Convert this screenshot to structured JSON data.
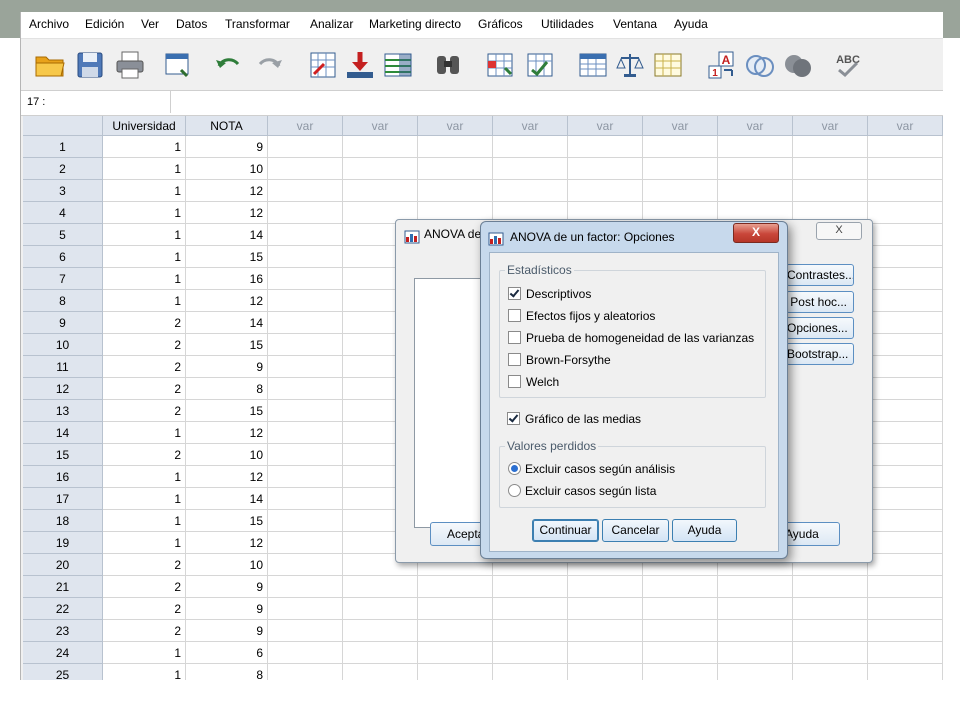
{
  "menu": [
    "Archivo",
    "Edición",
    "Ver",
    "Datos",
    "Transformar",
    "Analizar",
    "Marketing directo",
    "Gráficos",
    "Utilidades",
    "Ventana",
    "Ayuda"
  ],
  "toolbar_icons": [
    "open-folder-icon",
    "save-icon",
    "print-icon",
    "recall-dialog-icon",
    "undo-icon",
    "redo-icon",
    "go-to-case-icon",
    "go-to-variable-icon",
    "variables-icon",
    "find-icon",
    "insert-cases-icon",
    "insert-variable-icon",
    "split-file-icon",
    "weight-cases-icon",
    "select-cases-icon",
    "value-labels-icon",
    "use-sets-icon",
    "show-all-variables-icon",
    "spell-check-icon"
  ],
  "cell_ref": "17 :",
  "grid": {
    "columns": [
      "Universidad",
      "NOTA",
      "var",
      "var",
      "var",
      "var",
      "var",
      "var",
      "var",
      "var",
      "var"
    ],
    "rows": [
      [
        "1",
        "1",
        "9"
      ],
      [
        "2",
        "1",
        "10"
      ],
      [
        "3",
        "1",
        "12"
      ],
      [
        "4",
        "1",
        "12"
      ],
      [
        "5",
        "1",
        "14"
      ],
      [
        "6",
        "1",
        "15"
      ],
      [
        "7",
        "1",
        "16"
      ],
      [
        "8",
        "1",
        "12"
      ],
      [
        "9",
        "2",
        "14"
      ],
      [
        "10",
        "2",
        "15"
      ],
      [
        "11",
        "2",
        "9"
      ],
      [
        "12",
        "2",
        "8"
      ],
      [
        "13",
        "2",
        "15"
      ],
      [
        "14",
        "1",
        "12"
      ],
      [
        "15",
        "2",
        "10"
      ],
      [
        "16",
        "1",
        "12"
      ],
      [
        "17",
        "1",
        "14"
      ],
      [
        "18",
        "1",
        "15"
      ],
      [
        "19",
        "1",
        "12"
      ],
      [
        "20",
        "2",
        "10"
      ],
      [
        "21",
        "2",
        "9"
      ],
      [
        "22",
        "2",
        "9"
      ],
      [
        "23",
        "2",
        "9"
      ],
      [
        "24",
        "1",
        "6"
      ],
      [
        "25",
        "1",
        "8"
      ]
    ]
  },
  "back_dialog": {
    "title": "ANOVA de",
    "close": "X",
    "side_buttons": [
      "Contrastes...",
      "Post hoc...",
      "Opciones...",
      "Bootstrap..."
    ],
    "ok": "Aceptar",
    "help": "Ayuda"
  },
  "options_dialog": {
    "title": "ANOVA de un factor: Opciones",
    "close": "X",
    "stats_label": "Estadísticos",
    "stats": [
      {
        "label": "Descriptivos",
        "checked": true
      },
      {
        "label": "Efectos fijos y aleatorios",
        "checked": false
      },
      {
        "label": "Prueba de homogeneidad de las varianzas",
        "checked": false
      },
      {
        "label": "Brown-Forsythe",
        "checked": false
      },
      {
        "label": "Welch",
        "checked": false
      }
    ],
    "means_plot": {
      "label": "Gráfico de las medias",
      "checked": true
    },
    "missing_label": "Valores perdidos",
    "missing": [
      {
        "label": "Excluir casos según análisis",
        "selected": true
      },
      {
        "label": "Excluir casos según lista",
        "selected": false
      }
    ],
    "continue": "Continuar",
    "cancel": "Cancelar",
    "help": "Ayuda"
  }
}
